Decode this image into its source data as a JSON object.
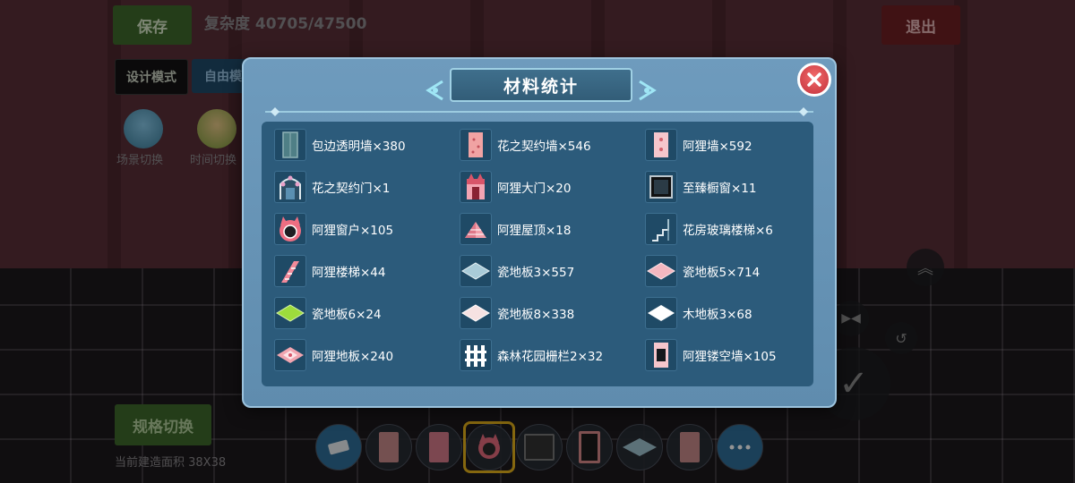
{
  "background": {
    "save_label": "保存",
    "complexity": "复杂度 40705/47500",
    "exit_label": "退出",
    "design_mode_label": "设计模式",
    "free_mode_label": "自由模",
    "scene_switch_label": "场景切换",
    "time_switch_label": "时间切换",
    "spec_switch_label": "规格切换",
    "build_area": "当前建造面积 38X38"
  },
  "dialog": {
    "title": "材料统计",
    "items": [
      {
        "text": "包边透明墙×380",
        "icon": "transparent-wall-icon"
      },
      {
        "text": "花之契约墙×546",
        "icon": "flower-wall-icon"
      },
      {
        "text": "阿狸墙×592",
        "icon": "ahri-wall-icon"
      },
      {
        "text": "花之契约门×1",
        "icon": "flower-door-icon"
      },
      {
        "text": "阿狸大门×20",
        "icon": "ahri-gate-icon"
      },
      {
        "text": "至臻橱窗×11",
        "icon": "showcase-window-icon"
      },
      {
        "text": "阿狸窗户×105",
        "icon": "ahri-window-icon"
      },
      {
        "text": "阿狸屋顶×18",
        "icon": "ahri-roof-icon"
      },
      {
        "text": "花房玻璃楼梯×6",
        "icon": "glass-stairs-icon"
      },
      {
        "text": "阿狸楼梯×44",
        "icon": "ahri-stairs-icon"
      },
      {
        "text": "瓷地板3×557",
        "icon": "tile-floor-3-icon"
      },
      {
        "text": "瓷地板5×714",
        "icon": "tile-floor-5-icon"
      },
      {
        "text": "瓷地板6×24",
        "icon": "tile-floor-6-icon"
      },
      {
        "text": "瓷地板8×338",
        "icon": "tile-floor-8-icon"
      },
      {
        "text": "木地板3×68",
        "icon": "wood-floor-3-icon"
      },
      {
        "text": "阿狸地板×240",
        "icon": "ahri-floor-icon"
      },
      {
        "text": "森林花园栅栏2×32",
        "icon": "fence-icon"
      },
      {
        "text": "阿狸镂空墙×105",
        "icon": "ahri-hollow-wall-icon"
      }
    ]
  }
}
